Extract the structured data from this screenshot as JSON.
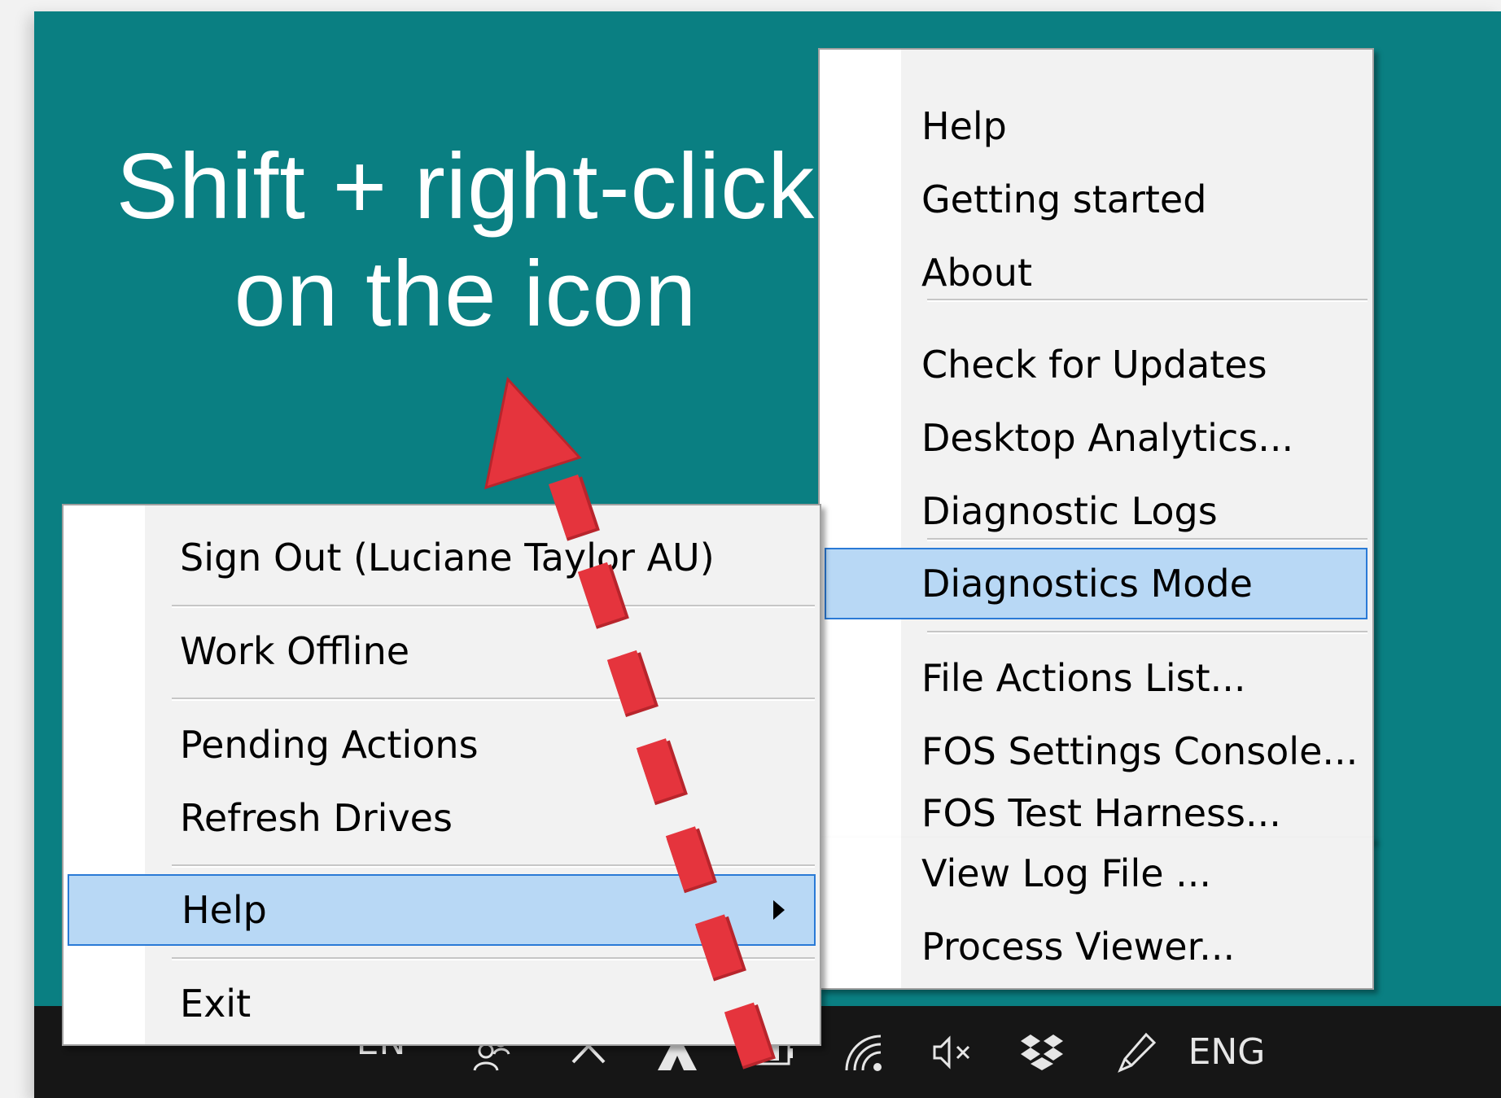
{
  "headline": {
    "line1": "Shift + right-click",
    "line2": "on the icon"
  },
  "context_menu": {
    "items": [
      {
        "label": "Sign Out (Luciane Taylor AU)"
      },
      {
        "label": "Work Offline"
      },
      {
        "label": "Pending Actions"
      },
      {
        "label": "Refresh Drives"
      },
      {
        "label": "Help",
        "highlighted": true,
        "has_submenu": true
      },
      {
        "label": "Exit"
      }
    ]
  },
  "help_submenu": {
    "items": [
      {
        "label": "Help"
      },
      {
        "label": "Getting started"
      },
      {
        "label": "About"
      },
      {
        "label": "Check for Updates"
      },
      {
        "label": "Desktop Analytics..."
      },
      {
        "label": "Diagnostic Logs"
      },
      {
        "label": "Diagnostics Mode",
        "highlighted": true
      },
      {
        "label": "File Actions List..."
      },
      {
        "label": "FOS Settings Console..."
      },
      {
        "label": "FOS Test Harness..."
      },
      {
        "label": "View Log File ..."
      },
      {
        "label": "Process Viewer..."
      }
    ]
  },
  "taskbar": {
    "language_en": "EN",
    "language_eng": "ENG",
    "icons": [
      "people-icon",
      "chevron-up-icon",
      "app-tray-icon",
      "battery-charging-icon",
      "wifi-icon",
      "speaker-muted-icon",
      "dropbox-icon",
      "pen-icon"
    ]
  },
  "colors": {
    "background_teal": "#0a7f82",
    "annotation_arrow": "#e5343d",
    "menu_highlight": "#b8d8f5",
    "menu_highlight_border": "#2a7ad6",
    "taskbar": "#161616"
  }
}
